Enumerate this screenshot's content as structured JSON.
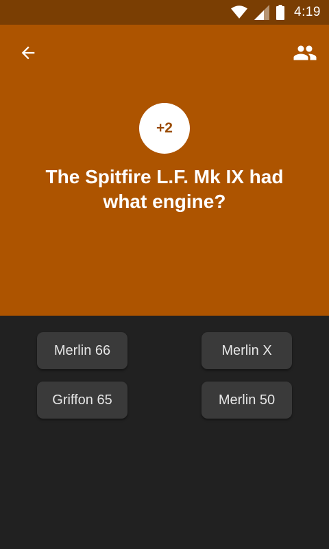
{
  "status_bar": {
    "time": "4:19",
    "icons": [
      "wifi-icon",
      "signal-icon",
      "battery-icon"
    ]
  },
  "header": {
    "back_icon": "arrow-back-icon",
    "people_icon": "people-icon",
    "points": "+2",
    "question": "The Spitfire L.F. Mk IX had what engine?"
  },
  "answers": [
    {
      "label": "Merlin 66"
    },
    {
      "label": "Merlin X"
    },
    {
      "label": "Griffon 65"
    },
    {
      "label": "Merlin 50"
    }
  ],
  "colors": {
    "status_bar": "#7a3e03",
    "header_bg": "#ad5400",
    "body_bg": "#212121",
    "button_bg": "#3a3a3a",
    "badge_text": "#9a4b00"
  }
}
